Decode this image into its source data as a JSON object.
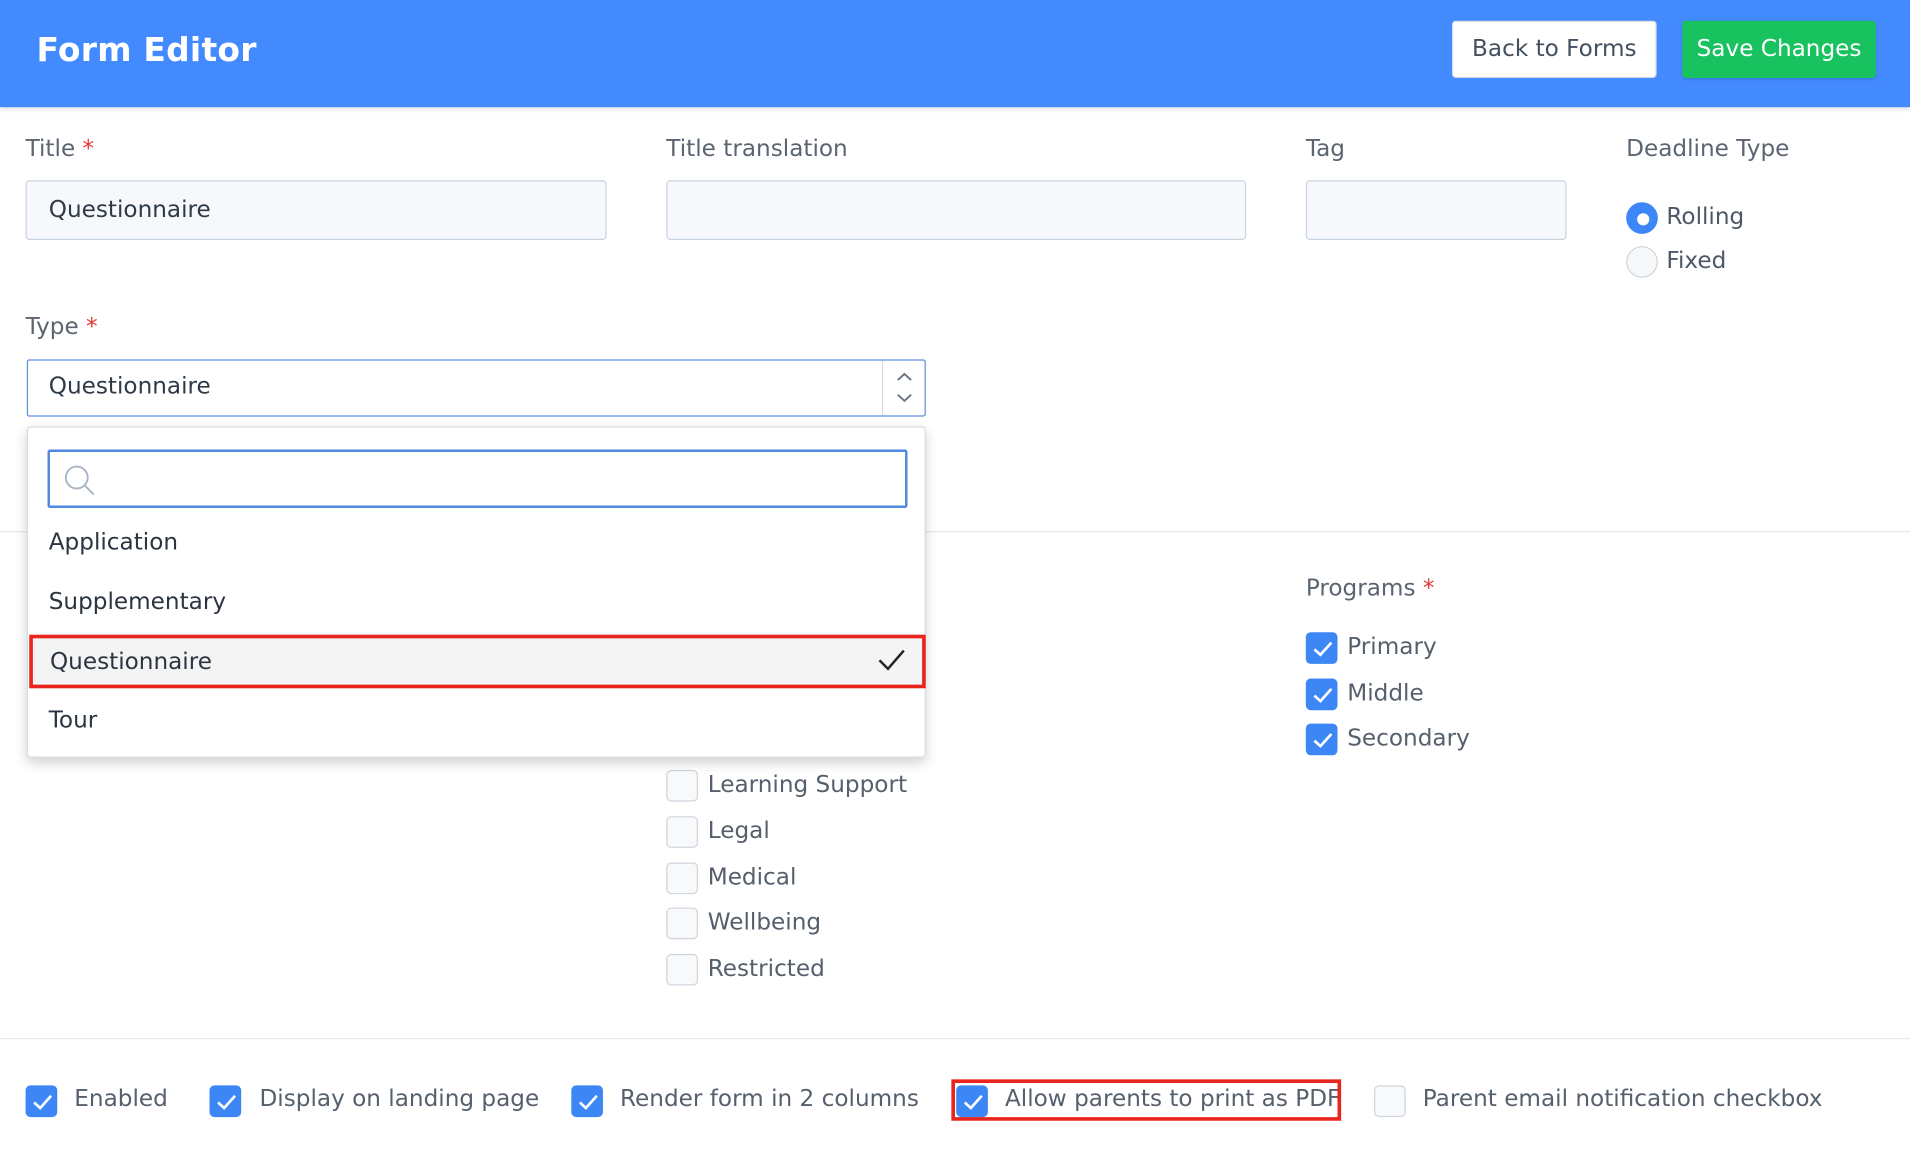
{
  "header": {
    "title": "Form Editor",
    "back_label": "Back to Forms",
    "save_label": "Save Changes"
  },
  "fields": {
    "title": {
      "label": "Title",
      "required_mark": "*",
      "value": "Questionnaire"
    },
    "title_translation": {
      "label": "Title translation",
      "value": ""
    },
    "tag": {
      "label": "Tag",
      "value": ""
    },
    "deadline_type": {
      "label": "Deadline Type",
      "options": [
        "Rolling",
        "Fixed"
      ],
      "selected": "Rolling"
    },
    "type": {
      "label": "Type",
      "required_mark": "*",
      "value": "Questionnaire"
    }
  },
  "type_dropdown": {
    "search_value": "",
    "options": [
      "Application",
      "Supplementary",
      "Questionnaire",
      "Tour"
    ],
    "selected": "Questionnaire"
  },
  "categories": {
    "items": [
      {
        "label": "Learning Support",
        "checked": false
      },
      {
        "label": "Legal",
        "checked": false
      },
      {
        "label": "Medical",
        "checked": false
      },
      {
        "label": "Wellbeing",
        "checked": false
      },
      {
        "label": "Restricted",
        "checked": false
      }
    ]
  },
  "programs": {
    "label": "Programs",
    "required_mark": "*",
    "items": [
      {
        "label": "Primary",
        "checked": true
      },
      {
        "label": "Middle",
        "checked": true
      },
      {
        "label": "Secondary",
        "checked": true
      }
    ]
  },
  "options": {
    "items": [
      {
        "label": "Enabled",
        "checked": true
      },
      {
        "label": "Display on landing page",
        "checked": true
      },
      {
        "label": "Render form in 2 columns",
        "checked": true
      },
      {
        "label": "Allow parents to print as PDF",
        "checked": true
      },
      {
        "label": "Parent email notification checkbox",
        "checked": false
      }
    ]
  },
  "colors": {
    "header_bg": "#448aff",
    "save_button": "#18c35f",
    "checkbox_checked": "#3c87f5",
    "required_mark": "#e53935",
    "highlight": "#e8261d"
  },
  "icons": {
    "search": "search-icon",
    "check": "check-icon",
    "select_arrows": "chevron-up-down-icon"
  }
}
